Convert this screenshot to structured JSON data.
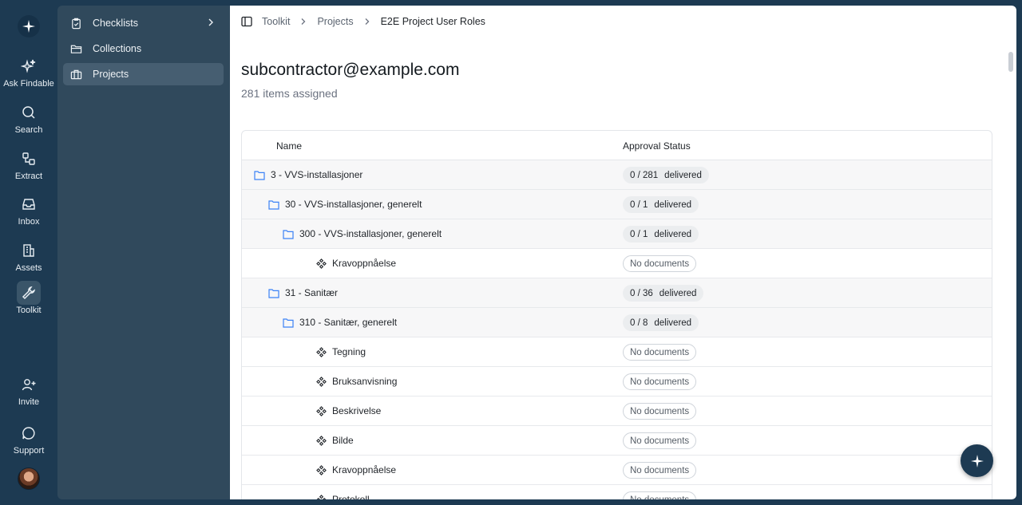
{
  "colors": {
    "brand_dark": "#1d3a52",
    "sidebar_bg": "#30495c",
    "folder_icon": "#3b82f6",
    "row_folder_bg": "#f7f7f8"
  },
  "rail": {
    "items": [
      {
        "label": "Ask Findable",
        "icon": "sparkles-icon"
      },
      {
        "label": "Search",
        "icon": "search-icon"
      },
      {
        "label": "Extract",
        "icon": "extract-icon"
      },
      {
        "label": "Inbox",
        "icon": "inbox-icon"
      },
      {
        "label": "Assets",
        "icon": "building-icon"
      },
      {
        "label": "Toolkit",
        "icon": "wrench-icon",
        "active": true
      },
      {
        "label": "Invite",
        "icon": "user-plus-icon"
      },
      {
        "label": "Support",
        "icon": "chat-bubble-icon"
      }
    ]
  },
  "sidebar": {
    "items": [
      {
        "label": "Checklists",
        "icon": "clipboard-check-icon"
      },
      {
        "label": "Collections",
        "icon": "folder-icon"
      },
      {
        "label": "Projects",
        "icon": "briefcase-icon",
        "active": true
      }
    ]
  },
  "breadcrumb": [
    "Toolkit",
    "Projects",
    "E2E Project User Roles"
  ],
  "page": {
    "title": "subcontractor@example.com",
    "subtitle": "281 items assigned"
  },
  "table": {
    "columns": [
      "Name",
      "Approval Status"
    ],
    "delivered_label": "delivered",
    "no_docs_label": "No documents",
    "rows": [
      {
        "type": "folder",
        "depth": 0,
        "name": "3 - VVS-installasjoner",
        "status": "0 / 281"
      },
      {
        "type": "folder",
        "depth": 1,
        "name": "30 - VVS-installasjoner, generelt",
        "status": "0 / 1"
      },
      {
        "type": "folder",
        "depth": 2,
        "name": "300 - VVS-installasjoner, generelt",
        "status": "0 / 1"
      },
      {
        "type": "item",
        "depth": 3,
        "name": "Kravoppnåelse",
        "status": null
      },
      {
        "type": "folder",
        "depth": 1,
        "name": "31 - Sanitær",
        "status": "0 / 36"
      },
      {
        "type": "folder",
        "depth": 2,
        "name": "310 - Sanitær, generelt",
        "status": "0 / 8"
      },
      {
        "type": "item",
        "depth": 3,
        "name": "Tegning",
        "status": null
      },
      {
        "type": "item",
        "depth": 3,
        "name": "Bruksanvisning",
        "status": null
      },
      {
        "type": "item",
        "depth": 3,
        "name": "Beskrivelse",
        "status": null
      },
      {
        "type": "item",
        "depth": 3,
        "name": "Bilde",
        "status": null
      },
      {
        "type": "item",
        "depth": 3,
        "name": "Kravoppnåelse",
        "status": null
      },
      {
        "type": "item",
        "depth": 3,
        "name": "Protokoll",
        "status": null
      }
    ]
  }
}
